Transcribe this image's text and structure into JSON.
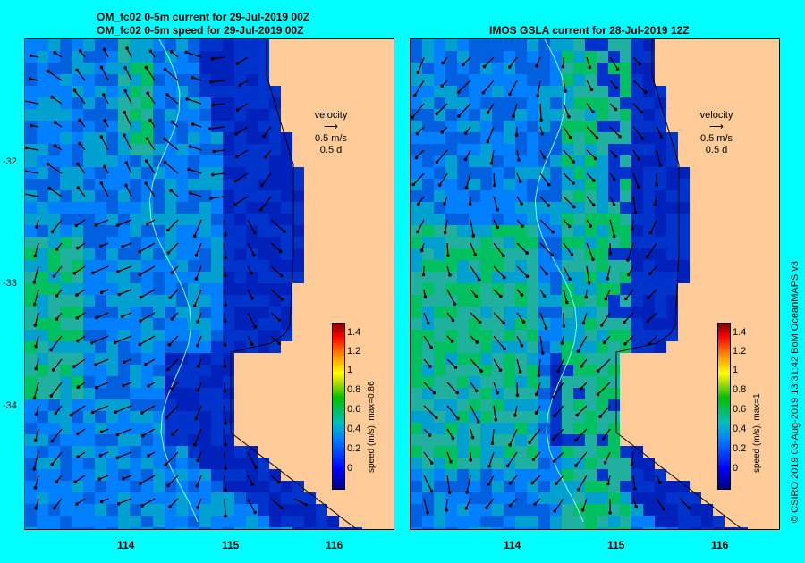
{
  "left_panel": {
    "title_line1": "OM_fc02 0-5m current for 29-Jul-2019 00Z",
    "title_line2": "OM_fc02 0-5m speed for 29-Jul-2019 00Z",
    "legend_title": "velocity",
    "legend_speed": "0.5 m/s",
    "legend_time": "0.5 d",
    "colorbar_label": "speed (m/s), max=0.86"
  },
  "right_panel": {
    "title": "IMOS GSLA current for 28-Jul-2019 12Z",
    "legend_title": "velocity",
    "legend_speed": "0.5 m/s",
    "legend_time": "0.5 d",
    "colorbar_label": "speed (m/s), max=1"
  },
  "x_ticks_left": [
    "114",
    "115",
    "116"
  ],
  "x_ticks_right": [
    "114",
    "115",
    "116"
  ],
  "y_ticks": [
    "-32",
    "-33",
    "-34"
  ],
  "colorbar_ticks": [
    "1.4",
    "1.2",
    "1",
    "0.8",
    "0.6",
    "0.4",
    "0.2",
    "0"
  ],
  "side_note": "© CSIRO 2019   03-Aug-2019 13:31:42 BoM OceanMAPS v3",
  "colors": {
    "frame": "#00ffff",
    "land": "#ffcc99",
    "deep": "#0033cc",
    "mid": "#0080ff",
    "high": "#00c060"
  }
}
